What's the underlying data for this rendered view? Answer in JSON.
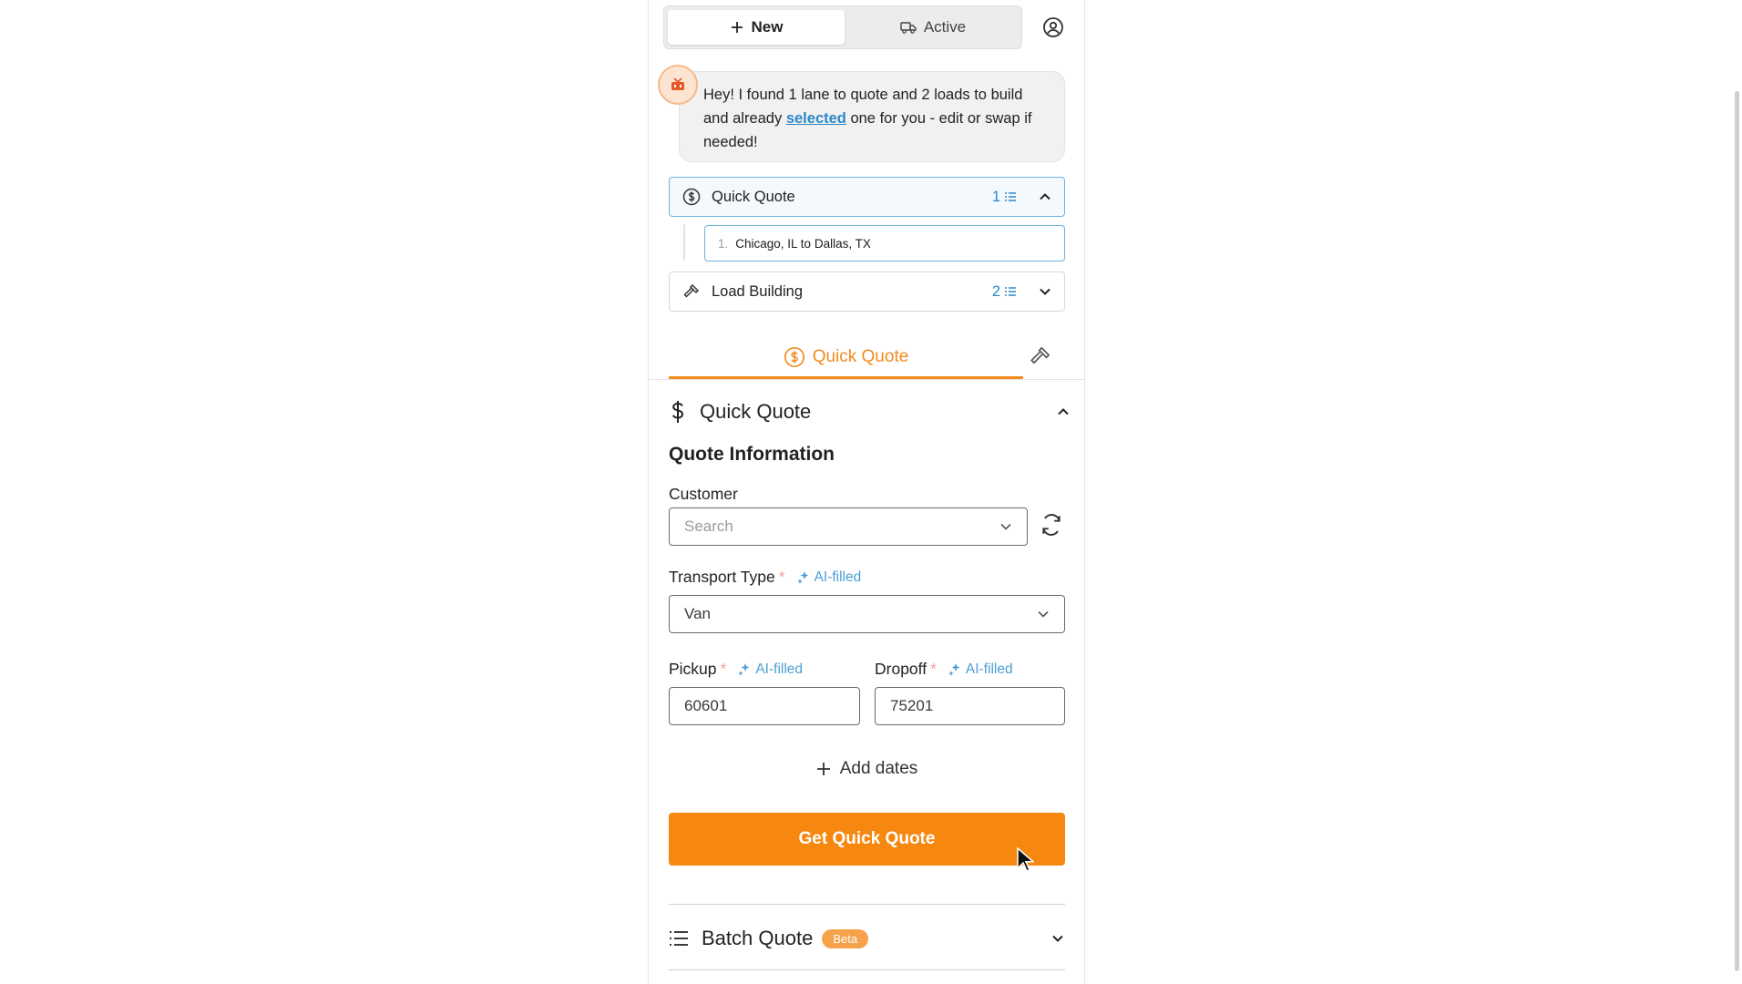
{
  "topbar": {
    "new_label": "New",
    "active_label": "Active",
    "new_icon": "plus-icon",
    "active_icon": "truck-icon",
    "profile_icon": "user-circle-icon"
  },
  "message": {
    "part1": "Hey! I found 1 lane to quote and 2 loads to build and already ",
    "link": "selected",
    "part2": " one for you - edit or swap if needed!"
  },
  "accordions": {
    "quick_quote": {
      "label": "Quick Quote",
      "count": "1",
      "icon": "dollar-circle-icon",
      "expanded": true
    },
    "load_building": {
      "label": "Load Building",
      "count": "2",
      "icon": "hammer-icon",
      "expanded": false
    }
  },
  "lanes": [
    {
      "num": "1.",
      "text": "Chicago, IL to Dallas, TX"
    }
  ],
  "tabs": {
    "quick_quote_label": "Quick Quote"
  },
  "section": {
    "title": "Quick Quote",
    "info_title": "Quote Information"
  },
  "form": {
    "customer_label": "Customer",
    "customer_placeholder": "Search",
    "transport_label": "Transport Type",
    "transport_value": "Van",
    "pickup_label": "Pickup",
    "pickup_value": "60601",
    "dropoff_label": "Dropoff",
    "dropoff_value": "75201",
    "required_mark": "*",
    "ai_filled": "AI-filled",
    "add_dates": "Add dates",
    "submit": "Get Quick Quote"
  },
  "batch": {
    "title": "Batch Quote",
    "badge": "Beta"
  },
  "colors": {
    "accent": "#f6880f",
    "link": "#2c88c9",
    "selected_border": "#6fb3e0"
  }
}
